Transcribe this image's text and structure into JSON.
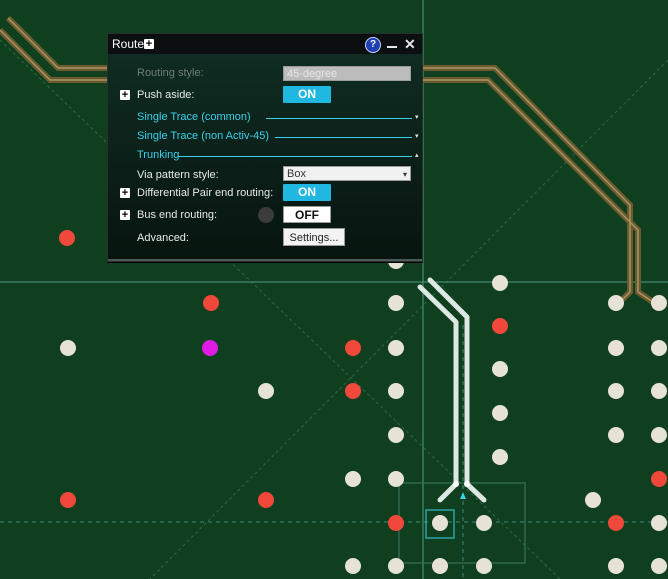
{
  "panel": {
    "title": "Route",
    "help_icon": "?",
    "routing_style_label": "Routing style:",
    "routing_style_value": "45-degree",
    "push_aside_label": "Push aside:",
    "push_aside_value": "ON",
    "sections": [
      "Single Trace (common)",
      "Single Trace (non Activ-45)",
      "Trunking"
    ],
    "via_pattern_label": "Via pattern style:",
    "via_pattern_value": "Box",
    "diff_pair_label": "Differential Pair end routing:",
    "diff_pair_value": "ON",
    "bus_end_label": "Bus end routing:",
    "bus_end_value": "OFF",
    "advanced_label": "Advanced:",
    "settings_button": "Settings..."
  },
  "colors": {
    "board": "#0f3f1f",
    "pad_white": "#e6e2d6",
    "pad_red": "#f0483a",
    "pad_magenta": "#e11be6",
    "trace_brown": "#6b5a2c",
    "trace_selected": "#dde8e3",
    "accent_cyan": "#3ad1ea",
    "toggle_on": "#20b8e0"
  }
}
